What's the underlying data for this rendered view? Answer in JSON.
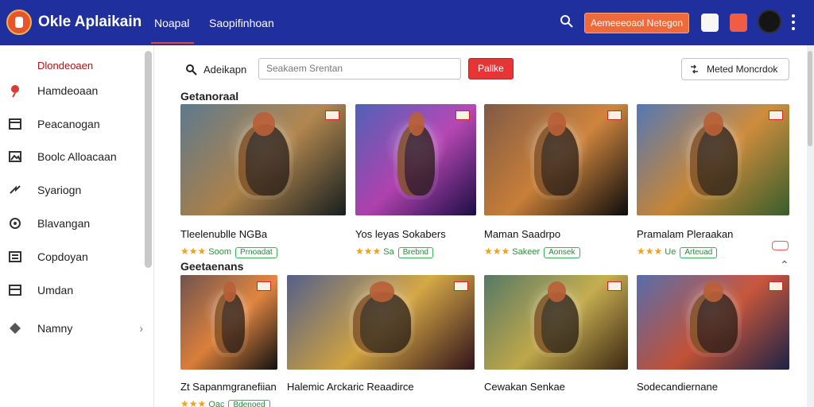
{
  "app": {
    "title": "Okle Aplaikain",
    "logo_icon": "app-logo-icon",
    "nav": [
      "Noapal",
      "Saopifinhoan"
    ],
    "cta": "Aemeeeoaol Netegon"
  },
  "sidebar": {
    "title": "Dlondeoaen",
    "items": [
      {
        "label": "Hamdeoaan",
        "icon": "pin-icon"
      },
      {
        "label": "Peacanogan",
        "icon": "calendar-icon"
      },
      {
        "label": "Boolc Alloacaan",
        "icon": "image-icon"
      },
      {
        "label": "Syariogn",
        "icon": "share-icon"
      },
      {
        "label": "Blavangan",
        "icon": "radio-icon"
      },
      {
        "label": "Copdoyan",
        "icon": "list-icon"
      },
      {
        "label": "Umdan",
        "icon": "table-icon"
      },
      {
        "label": "Namny",
        "icon": "diamond-icon"
      }
    ]
  },
  "search": {
    "label": "Adeikapn",
    "placeholder": "Seakaem Srentan",
    "button": "Pallke"
  },
  "sort_button": "Meted Moncrdok",
  "sections": [
    "Getanoraal",
    "Geetaenans"
  ],
  "cards_top": [
    {
      "title": "Tleelenublle NGBa",
      "rating": "Soom",
      "badge": "Prnoadat",
      "colors": [
        "#385c76",
        "#c38c45",
        "#1f292a"
      ]
    },
    {
      "title": "Yos leyas Sokabers",
      "rating": "Sa",
      "badge": "Brebnd",
      "colors": [
        "#2740a7",
        "#c83bc5",
        "#26125b"
      ]
    },
    {
      "title": "Maman Saadrpo",
      "rating": "Sakeer",
      "badge": "Aonsek",
      "colors": [
        "#63351c",
        "#e7892f",
        "#111"
      ]
    },
    {
      "title": "Pramalam Pleraakan",
      "rating": "Ue",
      "badge": "Arteuad",
      "colors": [
        "#2e5aa5",
        "#e7932d",
        "#4b7c3b"
      ]
    }
  ],
  "cards_bottom": [
    {
      "title": "Zt Sapanmgranefiian",
      "rating": "Oac",
      "badge": "Bdenoed",
      "colors": [
        "#4f2d28",
        "#ff8a32",
        "#171717"
      ]
    },
    {
      "title": "Halemic Arckaric Reaadirce",
      "rating": "",
      "badge": "",
      "colors": [
        "#2d3c73",
        "#f0b63a",
        "#411a24"
      ]
    },
    {
      "title": "Cewakan Senkae",
      "rating": "",
      "badge": "",
      "colors": [
        "#2f5b43",
        "#dbbd46",
        "#51351a"
      ]
    },
    {
      "title": "Sodecandiernane",
      "rating": "",
      "badge": "",
      "colors": [
        "#314d9c",
        "#df4f2d",
        "#272e5e"
      ]
    }
  ],
  "colors": {
    "topbar": "#1f2f9e",
    "accent": "#ef6a3a",
    "danger": "#e73535",
    "success": "#37b357"
  }
}
